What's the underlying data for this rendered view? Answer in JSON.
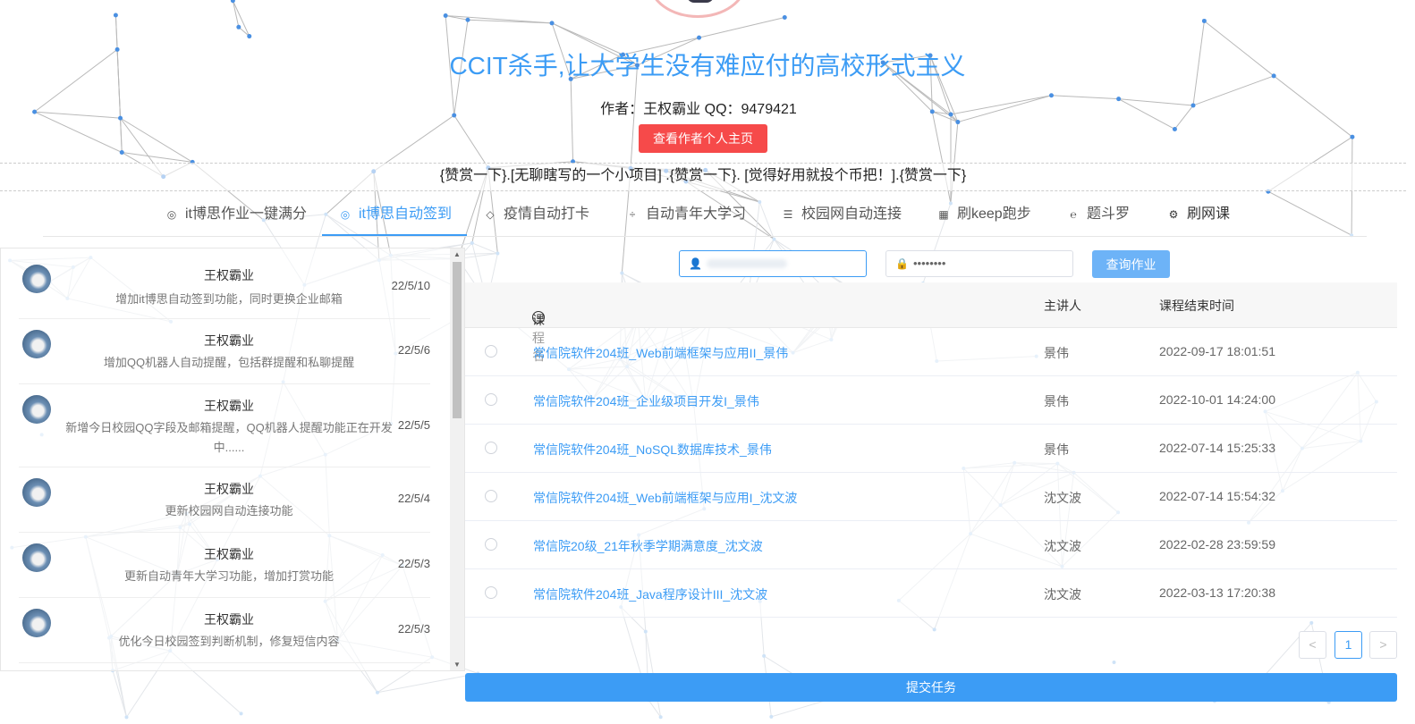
{
  "header": {
    "title": "CCIT杀手,让大学生没有难应付的高校形式主义",
    "author_line": "作者：王权霸业 QQ：9479421",
    "author_button": "查看作者个人主页",
    "tip_bar": "{赞赏一下}.[无聊瞎写的一个小项目] .{赞赏一下}. [觉得好用就投个币把！].{赞赏一下}"
  },
  "tabs": [
    {
      "label": "it博思作业一键满分",
      "icon": "layers-icon",
      "active": false
    },
    {
      "label": "it博思自动签到",
      "icon": "layers-icon",
      "active": true
    },
    {
      "label": "疫情自动打卡",
      "icon": "diamond-icon",
      "active": false
    },
    {
      "label": "自动青年大学习",
      "icon": "divide-icon",
      "active": false
    },
    {
      "label": "校园网自动连接",
      "icon": "list-icon",
      "active": false
    },
    {
      "label": "刷keep跑步",
      "icon": "grid-icon",
      "active": false
    },
    {
      "label": "题斗罗",
      "icon": "ie-icon",
      "active": false
    },
    {
      "label": "刷网课",
      "icon": "gear-icon",
      "active": false
    }
  ],
  "updates": [
    {
      "name": "王权霸业",
      "message": "增加it博思自动签到功能，同时更换企业邮箱",
      "date": "22/5/10"
    },
    {
      "name": "王权霸业",
      "message": "增加QQ机器人自动提醒，包括群提醒和私聊提醒",
      "date": "22/5/6"
    },
    {
      "name": "王权霸业",
      "message": "新增今日校园QQ字段及邮箱提醒，QQ机器人提醒功能正在开发中......",
      "date": "22/5/5"
    },
    {
      "name": "王权霸业",
      "message": "更新校园网自动连接功能",
      "date": "22/5/4"
    },
    {
      "name": "王权霸业",
      "message": "更新自动青年大学习功能，增加打赏功能",
      "date": "22/5/3"
    },
    {
      "name": "王权霸业",
      "message": "优化今日校园签到判断机制，修复短信内容",
      "date": "22/5/3"
    }
  ],
  "query": {
    "account_value": "",
    "password_value": "••••••••",
    "button": "查询作业"
  },
  "table": {
    "headers": {
      "course": "课程名",
      "teacher": "主讲人",
      "end_time": "课程结束时间"
    },
    "rows": [
      {
        "course": "常信院软件204班_Web前端框架与应用II_景伟",
        "teacher": "景伟",
        "end_time": "2022-09-17 18:01:51"
      },
      {
        "course": "常信院软件204班_企业级项目开发I_景伟",
        "teacher": "景伟",
        "end_time": "2022-10-01 14:24:00"
      },
      {
        "course": "常信院软件204班_NoSQL数据库技术_景伟",
        "teacher": "景伟",
        "end_time": "2022-07-14 15:25:33"
      },
      {
        "course": "常信院软件204班_Web前端框架与应用I_沈文波",
        "teacher": "沈文波",
        "end_time": "2022-07-14 15:54:32"
      },
      {
        "course": "常信院20级_21年秋季学期满意度_沈文波",
        "teacher": "沈文波",
        "end_time": "2022-02-28 23:59:59"
      },
      {
        "course": "常信院软件204班_Java程序设计III_沈文波",
        "teacher": "沈文波",
        "end_time": "2022-03-13 17:20:38"
      }
    ]
  },
  "pagination": {
    "prev": "<",
    "current": "1",
    "next": ">"
  },
  "submit_button": "提交任务",
  "colors": {
    "accent": "#3c9cf5",
    "danger": "#f64a4a"
  }
}
